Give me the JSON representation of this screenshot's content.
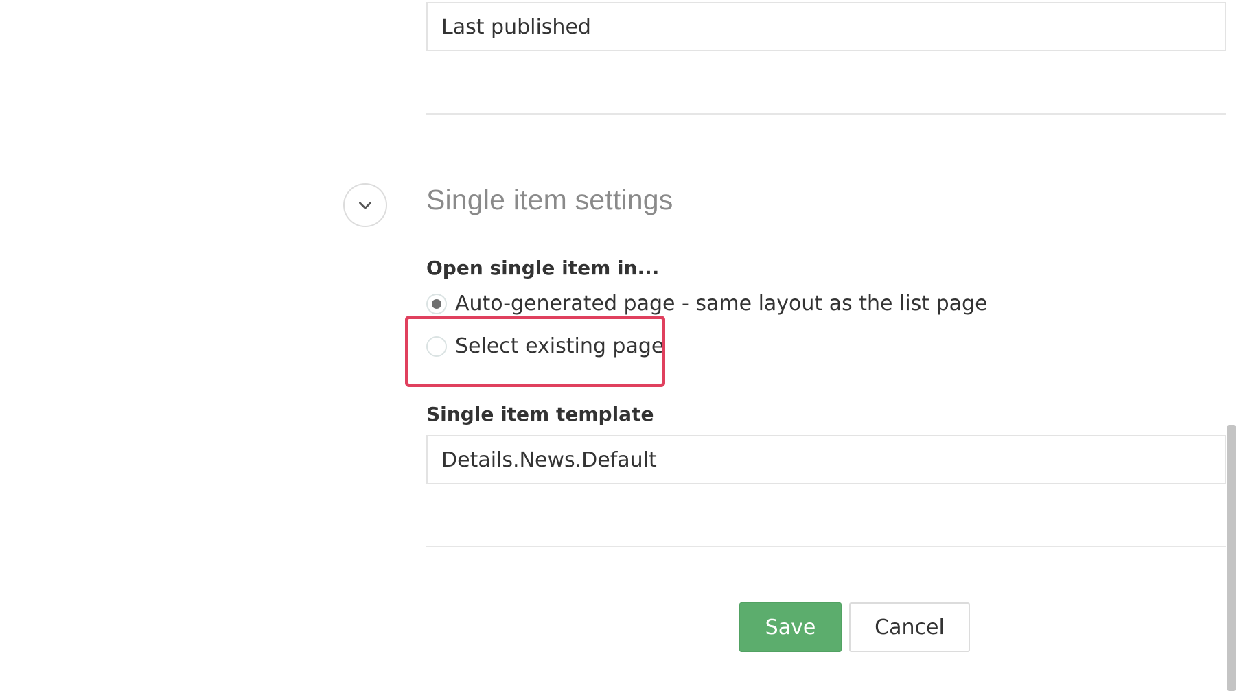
{
  "previous_field": {
    "value": "Last published"
  },
  "section": {
    "title": "Single item settings",
    "toggle_icon": "chevron-down-icon"
  },
  "open_single_item": {
    "label": "Open single item in...",
    "options": [
      {
        "label": "Auto-generated page - same layout as the list page",
        "selected": true
      },
      {
        "label": "Select existing page",
        "selected": false
      }
    ]
  },
  "single_item_template": {
    "label": "Single item template",
    "value": "Details.News.Default"
  },
  "actions": {
    "save_label": "Save",
    "cancel_label": "Cancel"
  },
  "colors": {
    "save_button": "#5cad6d",
    "highlight": "#e0405e",
    "title_text": "#8a8a8a"
  }
}
